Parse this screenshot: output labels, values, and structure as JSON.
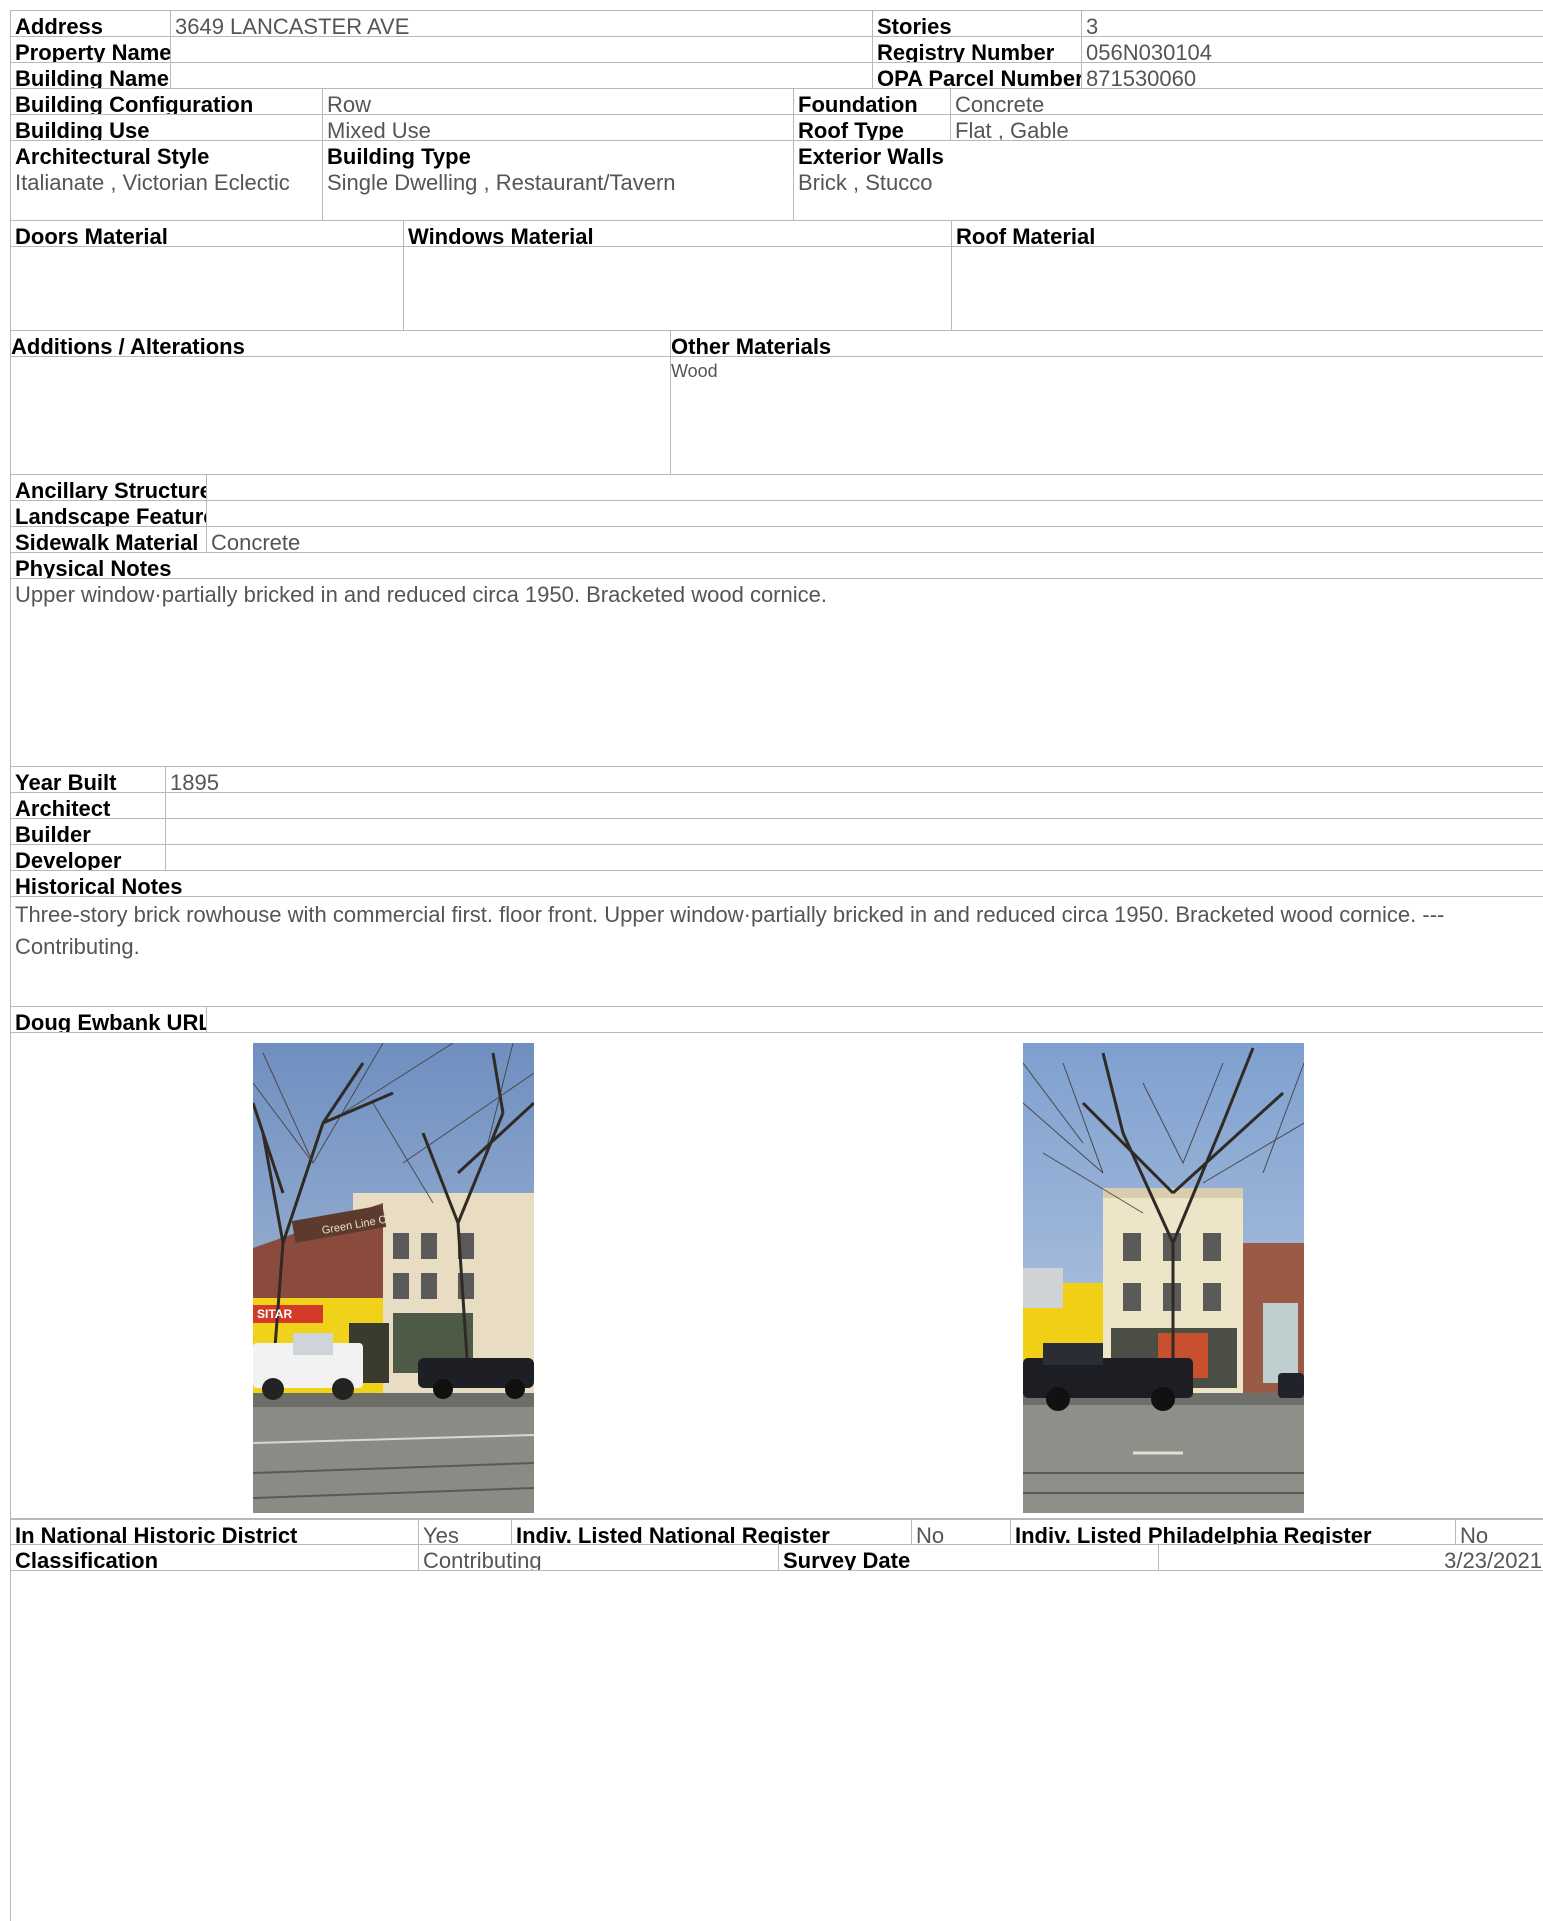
{
  "address": {
    "label": "Address",
    "value": "3649 LANCASTER AVE"
  },
  "stories": {
    "label": "Stories",
    "value": "3"
  },
  "property_name": {
    "label": "Property Name",
    "value": ""
  },
  "registry_number": {
    "label": "Registry Number",
    "value": "056N030104"
  },
  "building_name": {
    "label": "Building Name",
    "value": ""
  },
  "opa_parcel": {
    "label": "OPA Parcel Number",
    "value": "871530060"
  },
  "building_configuration": {
    "label": "Building Configuration",
    "value": "Row"
  },
  "foundation": {
    "label": "Foundation",
    "value": "Concrete"
  },
  "building_use": {
    "label": "Building Use",
    "value": "Mixed Use"
  },
  "roof_type": {
    "label": "Roof Type",
    "value": "Flat , Gable"
  },
  "architectural_style": {
    "label": "Architectural Style",
    "value": "Italianate , Victorian Eclectic"
  },
  "building_type": {
    "label": "Building Type",
    "value": "Single Dwelling , Restaurant/Tavern"
  },
  "exterior_walls": {
    "label": "Exterior Walls",
    "value": "Brick , Stucco"
  },
  "doors_material": {
    "label": "Doors Material",
    "value": ""
  },
  "windows_material": {
    "label": "Windows Material",
    "value": ""
  },
  "roof_material": {
    "label": "Roof Material",
    "value": ""
  },
  "additions": {
    "label": "Additions / Alterations",
    "value": ""
  },
  "other_materials": {
    "label": "Other Materials",
    "value": "Wood"
  },
  "ancillary": {
    "label": "Ancillary Structures",
    "value": ""
  },
  "landscape": {
    "label": "Landscape Features",
    "value": ""
  },
  "sidewalk": {
    "label": "Sidewalk Material",
    "value": "Concrete"
  },
  "physical_notes": {
    "label": "Physical Notes",
    "value": "Upper window·partially bricked in and reduced circa 1950. Bracketed wood cornice."
  },
  "year_built": {
    "label": "Year Built",
    "value": "1895"
  },
  "architect": {
    "label": "Architect",
    "value": ""
  },
  "builder": {
    "label": "Builder",
    "value": ""
  },
  "developer": {
    "label": "Developer",
    "value": ""
  },
  "historical_notes": {
    "label": "Historical Notes",
    "value": "Three-story brick rowhouse with commercial first. floor front. Upper window·partially bricked in and reduced circa 1950. Bracketed wood cornice. --- Contributing."
  },
  "doug_ewbank": {
    "label": "Doug Ewbank URL",
    "value": ""
  },
  "photos": [
    {
      "name": "street-photo-angled",
      "signs": [
        "Green Line Cafe",
        "SITAR"
      ]
    },
    {
      "name": "street-photo-front",
      "signs": []
    }
  ],
  "national_district": {
    "label": "In National Historic District",
    "value": "Yes"
  },
  "national_register": {
    "label": "Indiv. Listed National Register",
    "value": "No"
  },
  "philadelphia_register": {
    "label": "Indiv. Listed Philadelphia Register",
    "value": "No"
  },
  "classification": {
    "label": "Classification",
    "value": "Contributing"
  },
  "survey_date": {
    "label": "Survey Date",
    "value": "3/23/2021"
  }
}
